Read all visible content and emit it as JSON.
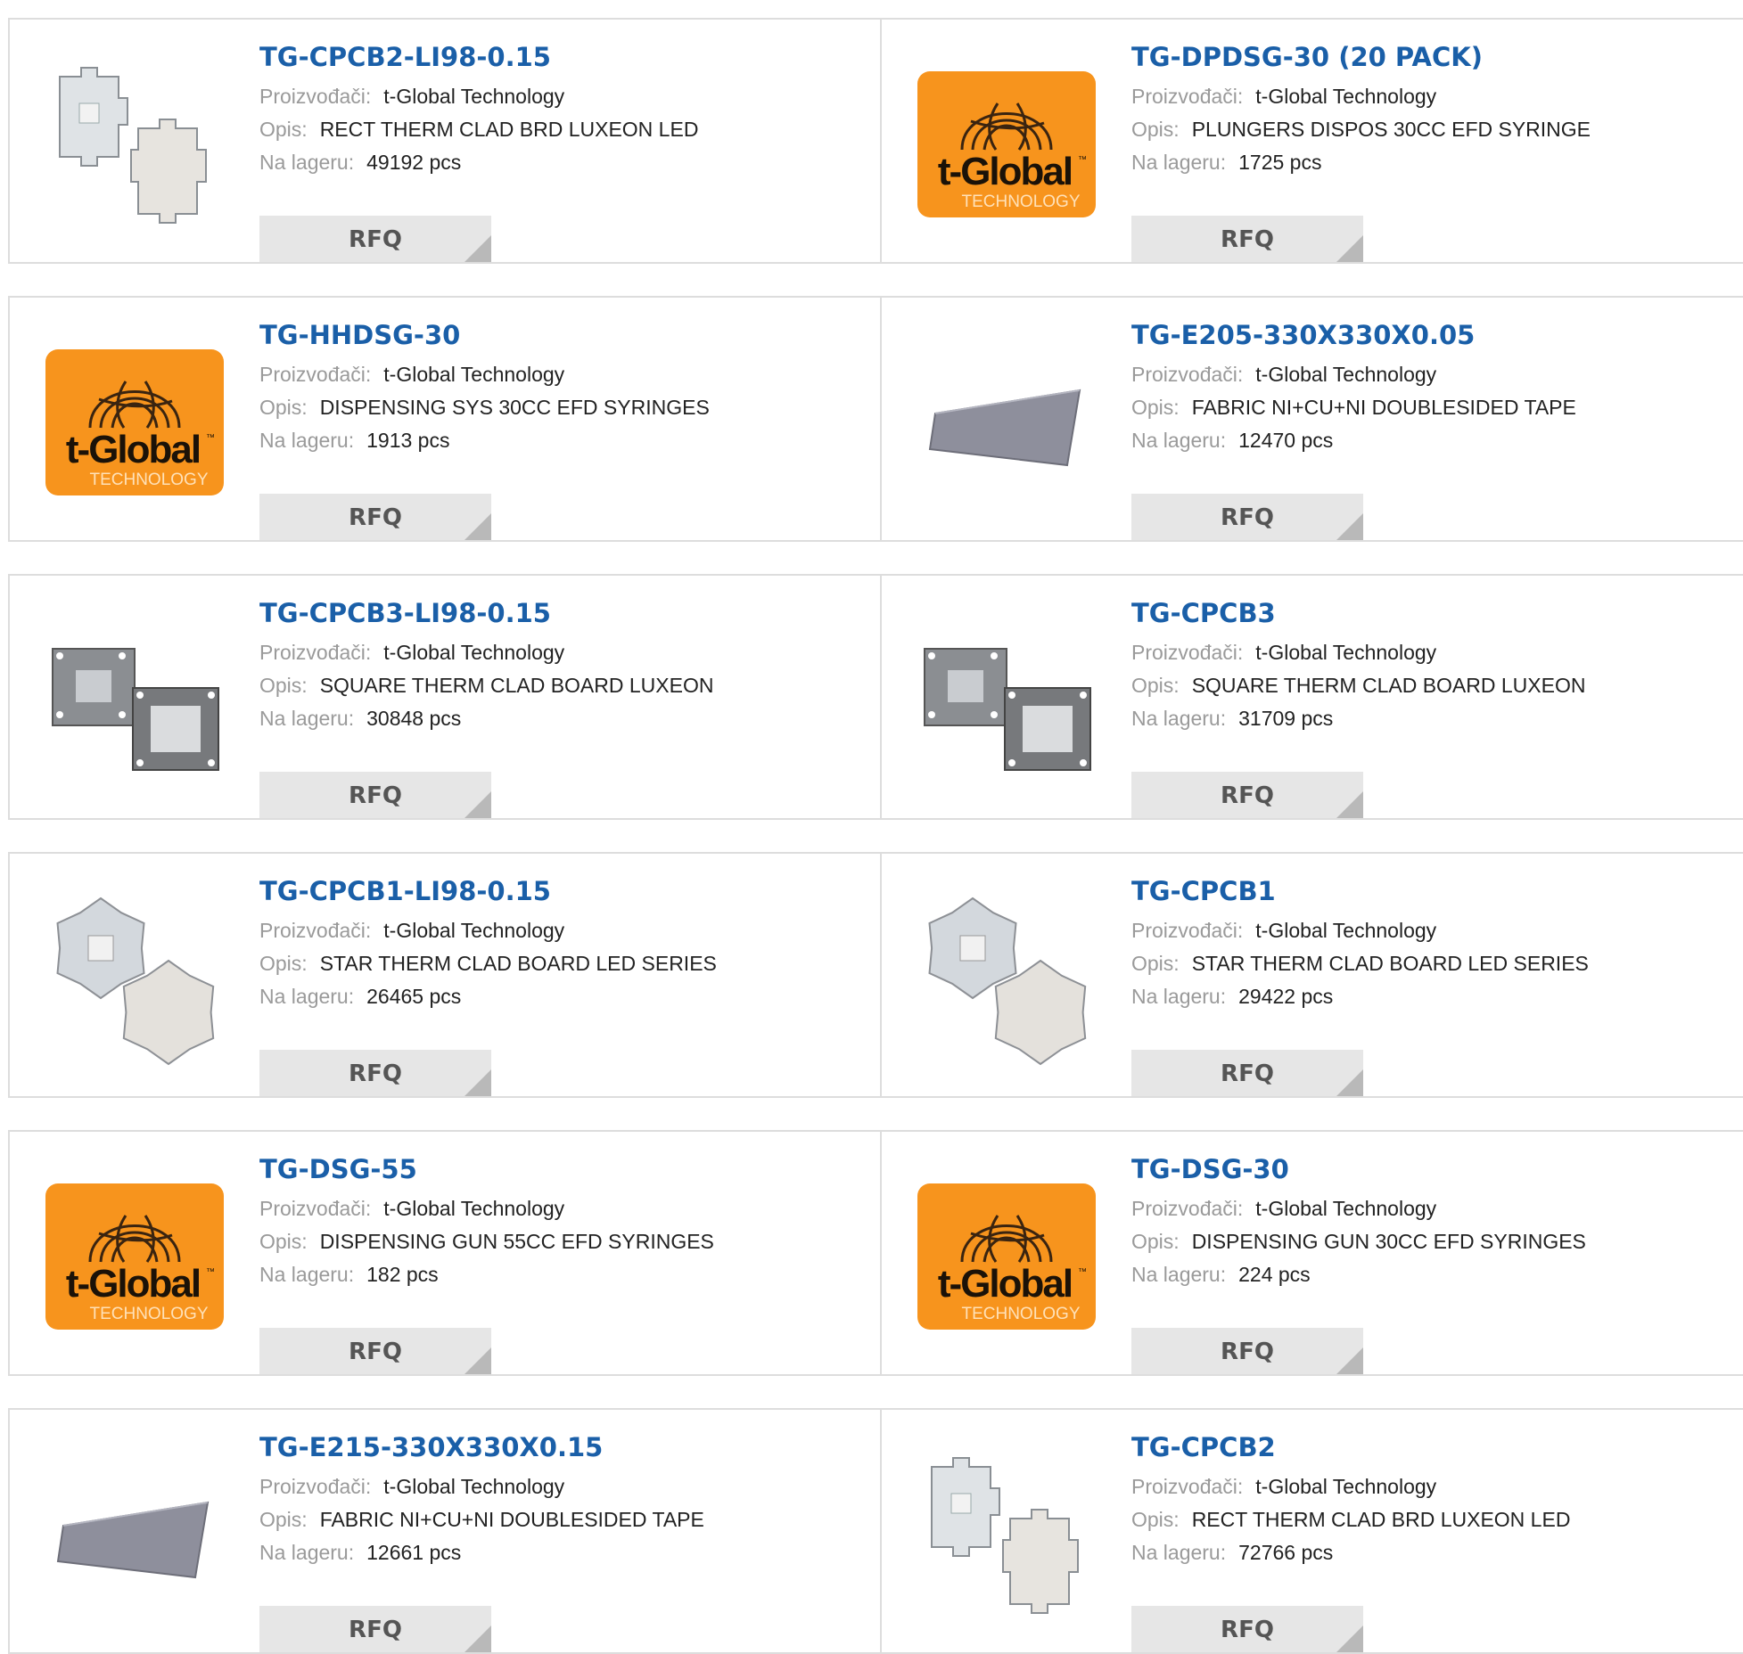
{
  "labels": {
    "manufacturer": "Proizvođači:",
    "description": "Opis:",
    "stock": "Na lageru:",
    "rfq": "RFQ"
  },
  "brand": {
    "logo_main": "t-Global",
    "logo_tm": "™",
    "logo_sub": "TECHNOLOGY",
    "logo_color": "#f7941d"
  },
  "products": [
    {
      "part": "TG-CPCB2-LI98-0.15",
      "manufacturer": "t-Global Technology",
      "description": "RECT THERM CLAD BRD LUXEON LED",
      "stock": "49192 pcs",
      "image": "rect-board-icon"
    },
    {
      "part": "TG-DPDSG-30 (20 PACK)",
      "manufacturer": "t-Global Technology",
      "description": "PLUNGERS DISPOS 30CC EFD SYRINGE",
      "stock": "1725 pcs",
      "image": "t-global-logo"
    },
    {
      "part": "TG-HHDSG-30",
      "manufacturer": "t-Global Technology",
      "description": "DISPENSING SYS 30CC EFD SYRINGES",
      "stock": "1913 pcs",
      "image": "t-global-logo"
    },
    {
      "part": "TG-E205-330X330X0.05",
      "manufacturer": "t-Global Technology",
      "description": "FABRIC NI+CU+NI DOUBLESIDED TAPE",
      "stock": "12470 pcs",
      "image": "fabric-tape-icon"
    },
    {
      "part": "TG-CPCB3-LI98-0.15",
      "manufacturer": "t-Global Technology",
      "description": "SQUARE THERM CLAD BOARD LUXEON",
      "stock": "30848 pcs",
      "image": "square-board-icon"
    },
    {
      "part": "TG-CPCB3",
      "manufacturer": "t-Global Technology",
      "description": "SQUARE THERM CLAD BOARD LUXEON",
      "stock": "31709 pcs",
      "image": "square-board-icon"
    },
    {
      "part": "TG-CPCB1-LI98-0.15",
      "manufacturer": "t-Global Technology",
      "description": "STAR THERM CLAD BOARD LED SERIES",
      "stock": "26465 pcs",
      "image": "star-board-icon"
    },
    {
      "part": "TG-CPCB1",
      "manufacturer": "t-Global Technology",
      "description": "STAR THERM CLAD BOARD LED SERIES",
      "stock": "29422 pcs",
      "image": "star-board-icon"
    },
    {
      "part": "TG-DSG-55",
      "manufacturer": "t-Global Technology",
      "description": "DISPENSING GUN 55CC EFD SYRINGES",
      "stock": "182 pcs",
      "image": "t-global-logo"
    },
    {
      "part": "TG-DSG-30",
      "manufacturer": "t-Global Technology",
      "description": "DISPENSING GUN 30CC EFD SYRINGES",
      "stock": "224 pcs",
      "image": "t-global-logo"
    },
    {
      "part": "TG-E215-330X330X0.15",
      "manufacturer": "t-Global Technology",
      "description": "FABRIC NI+CU+NI DOUBLESIDED TAPE",
      "stock": "12661 pcs",
      "image": "fabric-tape-icon"
    },
    {
      "part": "TG-CPCB2",
      "manufacturer": "t-Global Technology",
      "description": "RECT THERM CLAD BRD LUXEON LED",
      "stock": "72766 pcs",
      "image": "rect-board-icon"
    }
  ]
}
